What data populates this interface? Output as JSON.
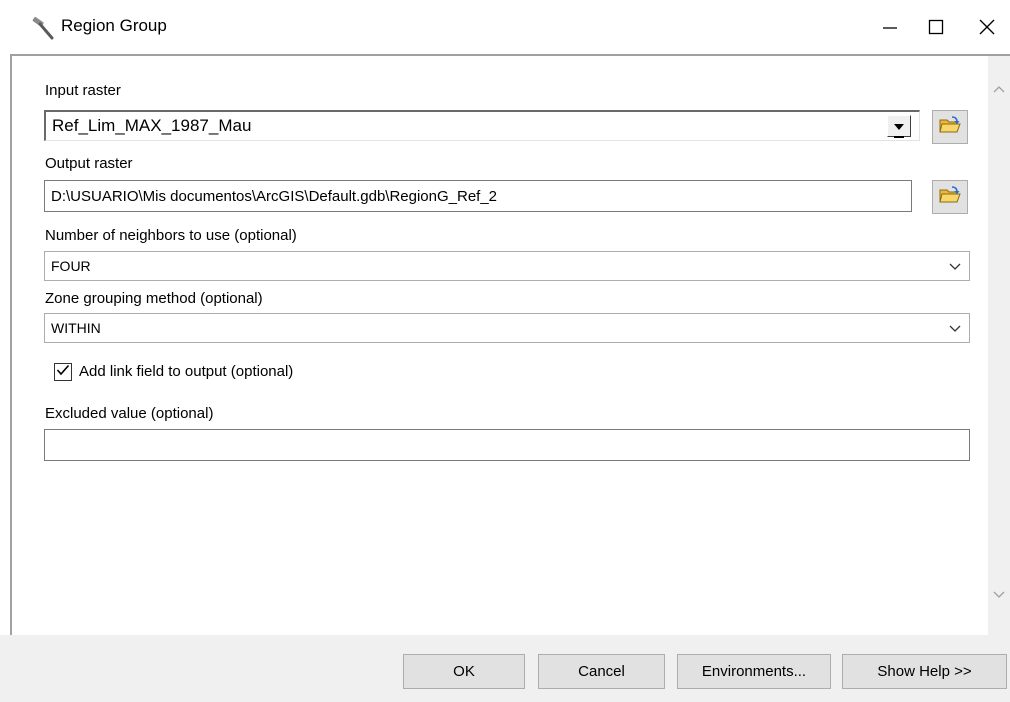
{
  "window": {
    "title": "Region Group",
    "minimize_icon": "minimize-icon",
    "maximize_icon": "maximize-icon",
    "close_icon": "close-icon",
    "app_icon": "hammer-icon"
  },
  "form": {
    "input_raster": {
      "label": "Input raster",
      "value": "Ref_Lim_MAX_1987_Mau",
      "browse_icon": "open-folder-icon"
    },
    "output_raster": {
      "label": "Output raster",
      "value": "D:\\USUARIO\\Mis documentos\\ArcGIS\\Default.gdb\\RegionG_Ref_2",
      "browse_icon": "open-folder-icon"
    },
    "neighbors": {
      "label": "Number of neighbors to use (optional)",
      "value": "FOUR"
    },
    "zone_grouping": {
      "label": "Zone grouping method (optional)",
      "value": "WITHIN"
    },
    "add_link": {
      "label": "Add link field to output (optional)",
      "checked": true
    },
    "excluded_value": {
      "label": "Excluded value (optional)",
      "value": ""
    }
  },
  "buttons": {
    "ok": "OK",
    "cancel": "Cancel",
    "environments": "Environments...",
    "show_help": "Show Help >>"
  },
  "colors": {
    "bottom_bar": "#f0f0f0",
    "button_face": "#e1e1e1",
    "folder_yellow": "#f2c94c"
  }
}
